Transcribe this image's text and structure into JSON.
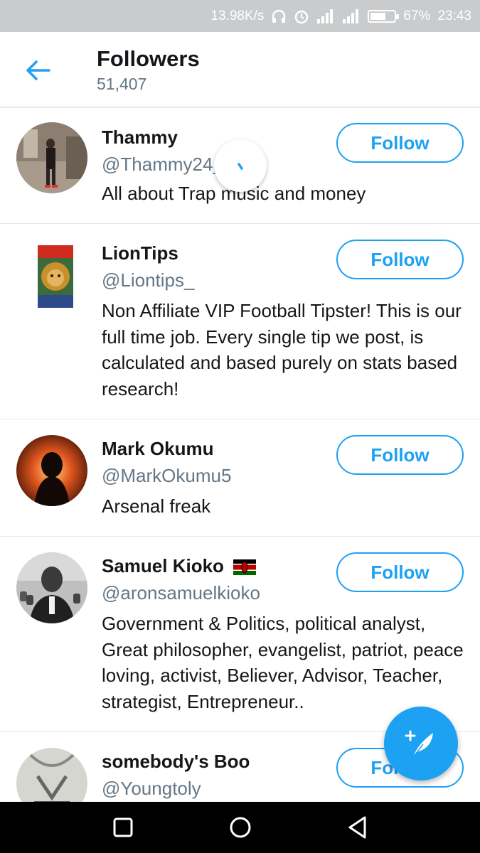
{
  "status_bar": {
    "speed": "13.98K/s",
    "battery": "67%",
    "battery_level": 0.67,
    "time": "23:43"
  },
  "header": {
    "title": "Followers",
    "count": "51,407"
  },
  "followers": [
    {
      "name": "Thammy",
      "handle": "@Thammy24__03",
      "bio": "All about Trap music and money",
      "button": "Follow"
    },
    {
      "name": "LionTips",
      "handle": "@Liontips_",
      "bio": "Non Affiliate VIP Football Tipster! This is our full time job. Every single tip we post, is calculated and based purely on stats based research!",
      "button": "Follow"
    },
    {
      "name": "Mark Okumu",
      "handle": "@MarkOkumu5",
      "bio": "Arsenal freak",
      "button": "Follow"
    },
    {
      "name": "Samuel Kioko",
      "handle": "@aronsamuelkioko",
      "bio": "Government & Politics, political analyst, Great philosopher, evangelist, patriot, peace loving, activist, Believer, Advisor, Teacher, strategist, Entrepreneur..",
      "button": "Follow"
    },
    {
      "name": "somebody's Boo",
      "handle": "@Youngtoly",
      "bio": "",
      "button": "Follow"
    }
  ],
  "colors": {
    "accent": "#1da1f2",
    "secondary_text": "#657786",
    "status_bar": "#c9cbcd"
  }
}
